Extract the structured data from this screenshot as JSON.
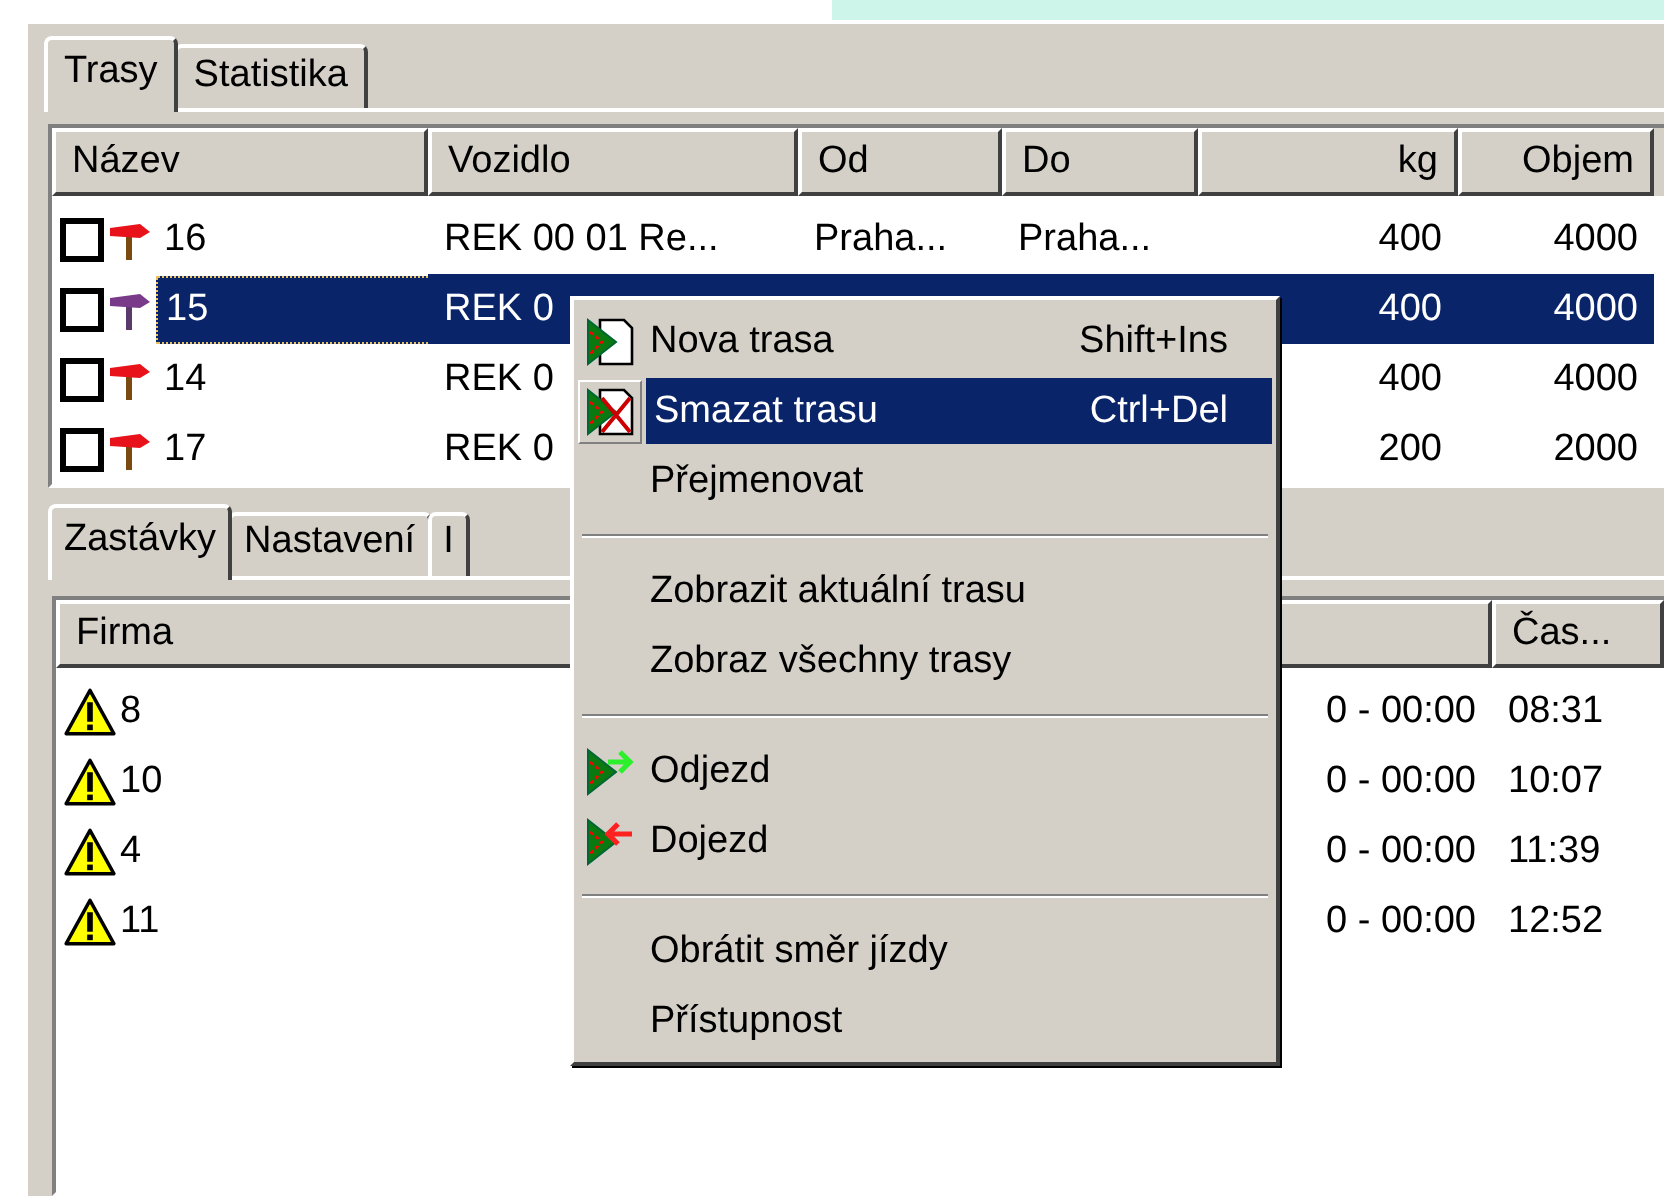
{
  "tabs": [
    {
      "label": "Trasy",
      "selected": true
    },
    {
      "label": "Statistika",
      "selected": false
    }
  ],
  "routes": {
    "columns": [
      "Název",
      "Vozidlo",
      "Od",
      "Do",
      "kg",
      "Objem"
    ],
    "rows": [
      {
        "checked": false,
        "selected": false,
        "name": "16",
        "vehicle": "REK 00 01 Re...",
        "from": "Praha...",
        "to": "Praha...",
        "kg": "400",
        "volume": "4000"
      },
      {
        "checked": false,
        "selected": true,
        "name": "15",
        "vehicle": "REK 0",
        "kg": "400",
        "volume": "4000"
      },
      {
        "checked": false,
        "selected": false,
        "name": "14",
        "vehicle": "REK 0",
        "kg": "400",
        "volume": "4000"
      },
      {
        "checked": false,
        "selected": false,
        "name": "17",
        "vehicle": "REK 0",
        "kg": "200",
        "volume": "2000"
      }
    ]
  },
  "subtabs": [
    {
      "label": "Zastávky",
      "selected": true
    },
    {
      "label": "Nastavení",
      "selected": false
    },
    {
      "label": "I",
      "selected": false
    }
  ],
  "stops": {
    "columns": [
      "Firma",
      "Čas..."
    ],
    "rows": [
      {
        "name": "8",
        "interval": "0 - 00:00",
        "time": "08:31"
      },
      {
        "name": "10",
        "interval": "0 - 00:00",
        "time": "10:07"
      },
      {
        "name": "4",
        "interval": "0 - 00:00",
        "time": "11:39"
      },
      {
        "name": "11",
        "interval": "0 - 00:00",
        "time": "12:52"
      }
    ]
  },
  "menu": {
    "items": [
      {
        "kind": "new",
        "label": "Nova trasa",
        "shortcut": "Shift+Ins",
        "selected": false
      },
      {
        "kind": "delete",
        "label": "Smazat trasu",
        "shortcut": "Ctrl+Del",
        "selected": true
      },
      {
        "kind": "plain",
        "label": "Přejmenovat",
        "selected": false
      },
      {
        "kind": "separator"
      },
      {
        "kind": "plain",
        "label": "Zobrazit aktuální trasu",
        "selected": false
      },
      {
        "kind": "plain",
        "label": "Zobraz všechny trasy",
        "selected": false
      },
      {
        "kind": "separator"
      },
      {
        "kind": "depart",
        "label": "Odjezd",
        "selected": false
      },
      {
        "kind": "arrive",
        "label": "Dojezd",
        "selected": false
      },
      {
        "kind": "separator"
      },
      {
        "kind": "plain",
        "label": "Obrátit směr jízdy",
        "selected": false
      },
      {
        "kind": "plain",
        "label": "Přístupnost",
        "selected": false
      }
    ]
  }
}
